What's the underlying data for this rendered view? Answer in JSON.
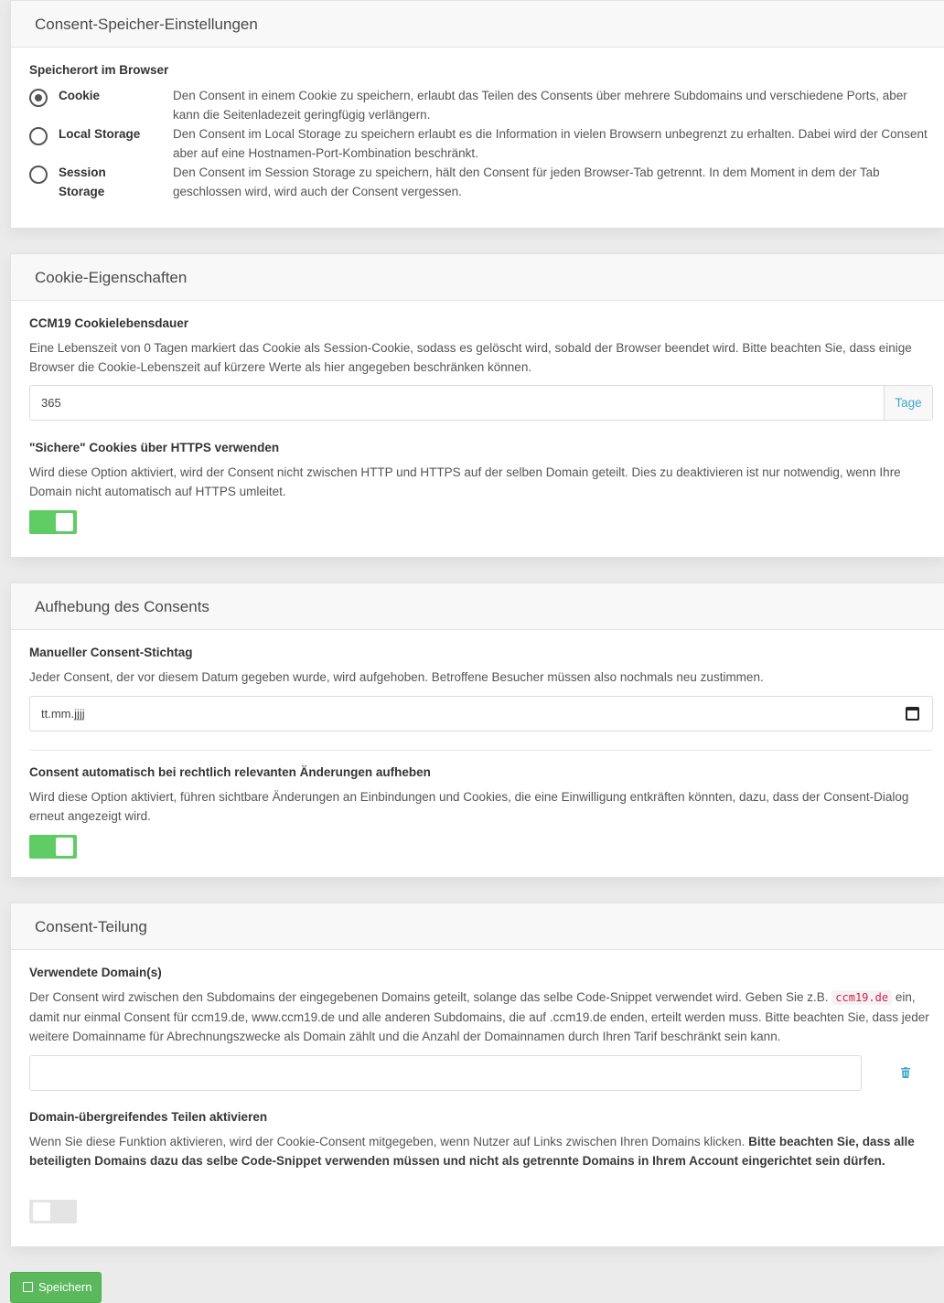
{
  "storage": {
    "header": "Consent-Speicher-Einstellungen",
    "label": "Speicherort im Browser",
    "options": [
      {
        "label": "Cookie",
        "selected": true,
        "desc": "Den Consent in einem Cookie zu speichern, erlaubt das Teilen des Consents über mehrere Subdomains und verschiedene Ports, aber kann die Seitenladezeit geringfügig verlängern."
      },
      {
        "label": "Local Storage",
        "selected": false,
        "desc": "Den Consent im Local Storage zu speichern erlaubt es die Information in vielen Browsern unbegrenzt zu erhalten. Dabei wird der Consent aber auf eine Hostnamen-Port-Kombination beschränkt."
      },
      {
        "label": "Session Storage",
        "selected": false,
        "desc": "Den Consent im Session Storage zu speichern, hält den Consent für jeden Browser-Tab getrennt. In dem Moment in dem der Tab geschlossen wird, wird auch der Consent vergessen."
      }
    ]
  },
  "cookie": {
    "header": "Cookie-Eigenschaften",
    "lifetime_label": "CCM19 Cookielebensdauer",
    "lifetime_desc": "Eine Lebenszeit von 0 Tagen markiert das Cookie als Session-Cookie, sodass es gelöscht wird, sobald der Browser beendet wird. Bitte beachten Sie, dass einige Browser die Cookie-Lebenszeit auf kürzere Werte als hier angegeben beschränken können.",
    "lifetime_value": "365",
    "lifetime_unit": "Tage",
    "secure_label": "\"Sichere\" Cookies über HTTPS verwenden",
    "secure_desc": "Wird diese Option aktiviert, wird der Consent nicht zwischen HTTP und HTTPS auf der selben Domain geteilt. Dies zu deaktivieren ist nur notwendig, wenn Ihre Domain nicht automatisch auf HTTPS umleitet.",
    "secure_enabled": true
  },
  "revocation": {
    "header": "Aufhebung des Consents",
    "date_label": "Manueller Consent-Stichtag",
    "date_desc": "Jeder Consent, der vor diesem Datum gegeben wurde, wird aufgehoben. Betroffene Besucher müssen also nochmals neu zustimmen.",
    "date_placeholder": "tt.mm.jjjj",
    "auto_label": "Consent automatisch bei rechtlich relevanten Änderungen aufheben",
    "auto_desc": "Wird diese Option aktiviert, führen sichtbare Änderungen an Einbindungen und Cookies, die eine Einwilligung entkräften könnten, dazu, dass der Consent-Dialog erneut angezeigt wird.",
    "auto_enabled": true
  },
  "sharing": {
    "header": "Consent-Teilung",
    "domains_label": "Verwendete Domain(s)",
    "domains_desc_1": "Der Consent wird zwischen den Subdomains der eingegebenen Domains geteilt, solange das selbe Code-Snippet verwendet wird. Geben Sie z.B.",
    "domains_example": "ccm19.de",
    "domains_desc_2": "ein, damit nur einmal Consent für ccm19.de, www.ccm19.de und alle anderen Subdomains, die auf .ccm19.de enden, erteilt werden muss. Bitte beachten Sie, dass jeder weitere Domainname für Abrechnungszwecke als Domain zählt und die Anzahl der Domainnamen durch Ihren Tarif beschränkt sein kann.",
    "domain_value": "",
    "cross_label": "Domain-übergreifendes Teilen aktivieren",
    "cross_desc": "Wenn Sie diese Funktion aktivieren, wird der Cookie-Consent mitgegeben, wenn Nutzer auf Links zwischen Ihren Domains klicken.",
    "cross_desc_bold": "Bitte beachten Sie, dass alle beteiligten Domains dazu das selbe Code-Snippet verwenden müssen und nicht als getrennte Domains in Ihrem Account eingerichtet sein dürfen.",
    "cross_enabled": false
  },
  "save_label": "Speichern",
  "colors": {
    "toggle_on": "#5fcd64",
    "save": "#5cb85c",
    "addon_text": "#3fa7c9",
    "code": "#c7254e"
  }
}
